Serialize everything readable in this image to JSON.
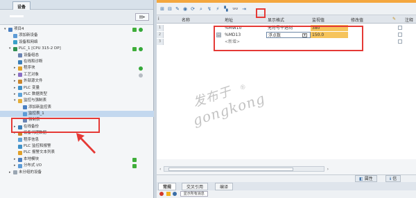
{
  "left_panel": {
    "title": "设备",
    "tree": [
      {
        "label": "项目4",
        "level": 0,
        "icon": "project-icon",
        "status": "both"
      },
      {
        "label": "添加新设备",
        "level": 1,
        "icon": "add-device-icon"
      },
      {
        "label": "设备和网络",
        "level": 1,
        "icon": "network-icon"
      },
      {
        "label": "PLC_1 [CPU 315-2 DP]",
        "level": 1,
        "icon": "plc-icon",
        "status": "both"
      },
      {
        "label": "设备组态",
        "level": 2,
        "icon": "device-config-icon"
      },
      {
        "label": "在线和诊断",
        "level": 2,
        "icon": "online-diag-icon"
      },
      {
        "label": "程序块",
        "level": 2,
        "icon": "program-blocks-icon",
        "status": "dot"
      },
      {
        "label": "工艺对象",
        "level": 2,
        "icon": "tech-objects-icon",
        "status": "gray"
      },
      {
        "label": "外部源文件",
        "level": 2,
        "icon": "ext-source-icon"
      },
      {
        "label": "PLC 变量",
        "level": 2,
        "icon": "plc-tags-icon"
      },
      {
        "label": "PLC 数据类型",
        "level": 2,
        "icon": "plc-datatype-icon"
      },
      {
        "label": "监控与强制表",
        "level": 2,
        "icon": "watch-force-icon"
      },
      {
        "label": "添加新监控表",
        "level": 3,
        "icon": "add-watch-icon"
      },
      {
        "label": "监控表_1",
        "level": 3,
        "icon": "watch-table-icon",
        "selected": true
      },
      {
        "label": "强制表",
        "level": 3,
        "icon": "force-table-icon"
      },
      {
        "label": "在线备份",
        "level": 2,
        "icon": "online-backup-icon"
      },
      {
        "label": "设备代理数据",
        "level": 2,
        "icon": "proxy-data-icon"
      },
      {
        "label": "程序信息",
        "level": 2,
        "icon": "program-info-icon"
      },
      {
        "label": "PLC 监控和报警",
        "level": 2,
        "icon": "plc-alarm-icon"
      },
      {
        "label": "PLC 报警文本列表",
        "level": 2,
        "icon": "alarm-text-icon"
      },
      {
        "label": "本地模块",
        "level": 2,
        "icon": "local-module-icon",
        "status": "sq"
      },
      {
        "label": "分布式 I/O",
        "level": 2,
        "icon": "dist-io-icon",
        "status": "sq"
      },
      {
        "label": "未分组的设备",
        "level": 1,
        "icon": "ungrouped-icon"
      }
    ]
  },
  "table": {
    "columns": [
      "i",
      "名称",
      "地址",
      "显示格式",
      "监视值",
      "修改值",
      "",
      "注释"
    ],
    "rows": [
      {
        "num": "1",
        "address": "%MW10",
        "format": "无符号十进制",
        "monitor": "380"
      },
      {
        "num": "2",
        "address": "%MD13",
        "format": "浮点数",
        "monitor": "150.0"
      },
      {
        "num": "3",
        "address": "<新增>",
        "format": "",
        "monitor": ""
      }
    ]
  },
  "bottom": {
    "tabs": [
      "常规",
      "交叉引用",
      "编译"
    ],
    "properties_label": "属性",
    "info_label": "信",
    "message_filter": "显示所有消息"
  },
  "watermark": {
    "line1": "发布于",
    "line2": "gongkong",
    "reg": "®"
  },
  "colors": {
    "accent_orange": "#f4a73f",
    "highlight_red": "#e53935",
    "status_green": "#3fae3a",
    "monitor_yellow": "#f6c45c"
  }
}
